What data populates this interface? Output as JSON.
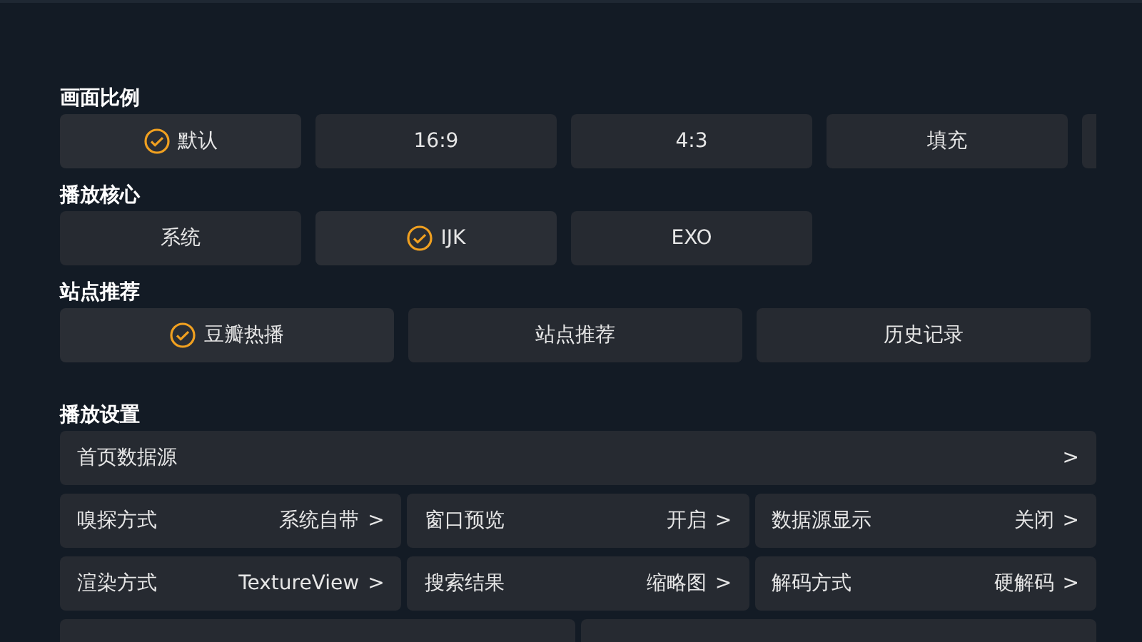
{
  "sections": [
    {
      "title": "画面比例",
      "kind": "small",
      "options": [
        {
          "label": "默认",
          "selected": true
        },
        {
          "label": "16:9",
          "selected": false
        },
        {
          "label": "4:3",
          "selected": false
        },
        {
          "label": "填充",
          "selected": false
        },
        {
          "kind": "partial"
        }
      ]
    },
    {
      "title": "播放核心",
      "kind": "small",
      "options": [
        {
          "label": "系统",
          "selected": false
        },
        {
          "label": "IJK",
          "selected": true
        },
        {
          "label": "EXO",
          "selected": false
        }
      ]
    },
    {
      "title": "站点推荐",
      "kind": "wide",
      "options": [
        {
          "label": "豆瓣热播",
          "selected": true
        },
        {
          "label": "站点推荐",
          "selected": false
        },
        {
          "label": "历史记录",
          "selected": false
        }
      ]
    }
  ],
  "settings": {
    "title": "播放设置",
    "rows": [
      [
        {
          "label": "首页数据源",
          "chevron": ">"
        }
      ],
      [
        {
          "label": "嗅探方式",
          "value": "系统自带",
          "chevron": ">"
        },
        {
          "label": "窗口预览",
          "value": "开启",
          "chevron": ">"
        },
        {
          "label": "数据源显示",
          "value": "关闭",
          "chevron": ">"
        }
      ],
      [
        {
          "label": "渲染方式",
          "value": "TextureView",
          "chevron": ">"
        },
        {
          "label": "搜索结果",
          "value": "缩略图",
          "chevron": ">"
        },
        {
          "label": "解码方式",
          "value": "硬解码",
          "chevron": ">"
        }
      ]
    ],
    "cut_off_tiles": [
      {
        "kind": "setting"
      },
      {
        "kind": "setting"
      }
    ]
  }
}
